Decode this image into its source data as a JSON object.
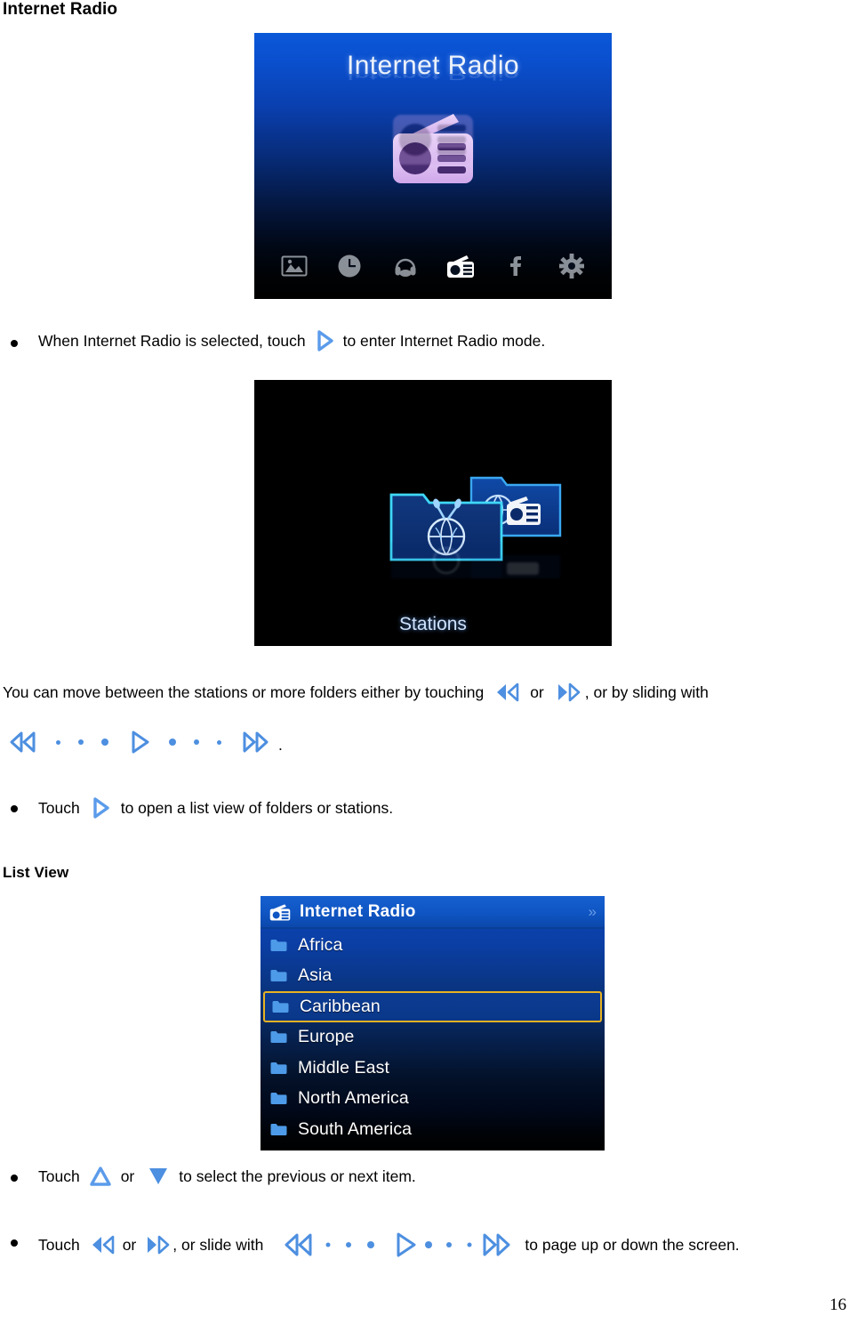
{
  "document": {
    "page_number": "16"
  },
  "headings": {
    "internet_radio": "Internet Radio",
    "list_view": "List View"
  },
  "screenshots": {
    "main_menu": {
      "title": "Internet Radio",
      "hero_icon": "radio-icon",
      "iconbar": [
        {
          "name": "picture-icon",
          "active": false
        },
        {
          "name": "clock-icon",
          "active": false
        },
        {
          "name": "headphones-icon",
          "active": false
        },
        {
          "name": "radio-icon",
          "active": true
        },
        {
          "name": "facebook-icon",
          "active": false
        },
        {
          "name": "gear-icon",
          "active": false
        }
      ]
    },
    "stations": {
      "label": "Stations",
      "folder_icons": [
        "globe-antenna-folder-icon",
        "globe-radio-folder-icon"
      ]
    },
    "list_view": {
      "header_title": "Internet Radio",
      "header_icon": "radio-icon",
      "header_more": "»",
      "selected_item": "Caribbean",
      "items": [
        {
          "label": "Africa",
          "icon": "folder-icon",
          "selected": false
        },
        {
          "label": "Asia",
          "icon": "folder-icon",
          "selected": false
        },
        {
          "label": "Caribbean",
          "icon": "folder-icon",
          "selected": true
        },
        {
          "label": "Europe",
          "icon": "folder-icon",
          "selected": false
        },
        {
          "label": "Middle East",
          "icon": "folder-icon",
          "selected": false
        },
        {
          "label": "North America",
          "icon": "folder-icon",
          "selected": false
        },
        {
          "label": "South America",
          "icon": "folder-icon",
          "selected": false
        }
      ]
    }
  },
  "instructions": {
    "line1_a": "When Internet Radio is selected, touch",
    "line1_b": "to enter Internet Radio mode.",
    "line2_a": "You can move between the stations or more folders either by touching",
    "line2_or": "or",
    "line2_b": ", or by sliding with",
    "line2_period": ".",
    "line3_a": "Touch",
    "line3_b": "to open a list view of folders or stations.",
    "line4_a": "Touch",
    "line4_or": "or",
    "line4_b": "to select the previous or next item.",
    "line5_a": "Touch",
    "line5_or": "or",
    "line5_b": ", or slide with",
    "line5_c": "to page up or down the screen."
  },
  "colors": {
    "accent_blue": "#4d8fe0",
    "highlight_gold": "#e8b222",
    "header_blue": "#0f55c3"
  }
}
